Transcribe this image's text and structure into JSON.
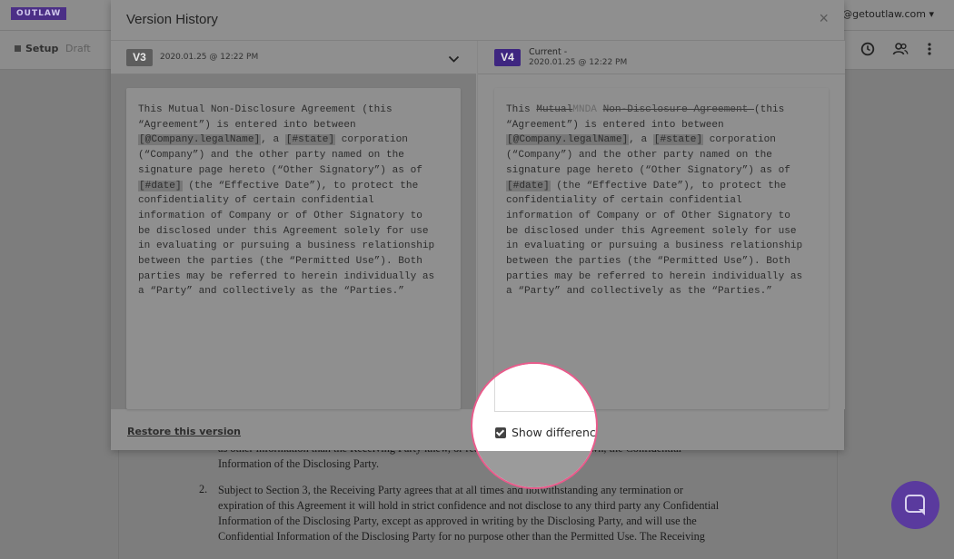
{
  "app": {
    "logo": "OUTLAW",
    "user_email": "an@getoutlaw.com ▾",
    "tabs": {
      "setup": "Setup",
      "draft": "Draft"
    }
  },
  "background_doc": {
    "line1": "as other information than the Receiving Party knew, or reasonably should have known, the Confidential",
    "line2": "Information of the Disclosing Party.",
    "item2_num": "2.",
    "item2_lines": [
      "Subject to Section 3, the Receiving Party agrees that at all times and notwithstanding any termination or",
      "expiration of this Agreement it will hold in strict confidence and not disclose to any third party any Confidential",
      "Information of the Disclosing Party, except as approved in writing by the Disclosing Party, and will use the",
      "Confidential Information of the Disclosing Party for no purpose other than the Permitted Use. The Receiving"
    ]
  },
  "modal": {
    "title": "Version History",
    "close": "×",
    "left": {
      "badge": "V3",
      "date": "2020.01.25 @ 12:22 PM"
    },
    "right": {
      "badge": "V4",
      "current": "Current -",
      "date": "2020.01.25 @ 12:22 PM"
    },
    "restore_label": "Restore this version",
    "show_differences_label": "Show differences",
    "show_differences_checked": true
  },
  "doc_v3": {
    "l1": "This Mutual Non-Disclosure Agreement (this",
    "l2": "“Agreement”) is entered into between",
    "l3_tok1": "[@Company.legalName]",
    "l3_mid": ", a ",
    "l3_tok2": "[#state]",
    "l3_end": " corporation",
    "l4": "(“Company”) and the other party named on the",
    "l5": "signature page hereto (“Other Signatory”) as of",
    "l6_tok": "[#date]",
    "l6_end": " (the “Effective Date”), to protect the",
    "l7": "confidentiality of certain confidential",
    "l8": "information of Company or of Other Signatory to",
    "l9": "be disclosed under this Agreement solely for use",
    "l10": "in evaluating or pursuing a business relationship",
    "l11": "between the parties (the “Permitted Use”). Both",
    "l12": "parties may be referred to herein individually as",
    "l13": "a “Party” and collectively as the “Parties.”"
  },
  "doc_v4": {
    "l1_a": "This ",
    "l1_del1": "Mutual",
    "l1_ins": "MNDA",
    "l1_sp": " ",
    "l1_del2": "Non-Disclosure Agreement ",
    "l1_end": "(this",
    "l2": "“Agreement”) is entered into between",
    "l3_tok1": "[@Company.legalName]",
    "l3_mid": ", a ",
    "l3_tok2": "[#state]",
    "l3_end": " corporation",
    "l4": "(“Company”) and the other party named on the",
    "l5": "signature page hereto (“Other Signatory”) as of",
    "l6_tok": "[#date]",
    "l6_end": " (the “Effective Date”), to protect the",
    "l7": "confidentiality of certain confidential",
    "l8": "information of Company or of Other Signatory to",
    "l9": "be disclosed under this Agreement solely for use",
    "l10": "in evaluating or pursuing a business relationship",
    "l11": "between the parties (the “Permitted Use”). Both",
    "l12": "parties may be referred to herein individually as",
    "l13": "a “Party” and collectively as the “Parties.”"
  },
  "icons": {
    "history": "clock-icon",
    "users": "users-icon",
    "more": "kebab-icon",
    "chat": "chat-icon",
    "chevron": "chevron-down-icon"
  },
  "colors": {
    "brand": "#4b2f86",
    "badge_v4": "#3e2680",
    "highlight_ring": "#e85b8b",
    "chat_button": "#5a3a9e"
  }
}
